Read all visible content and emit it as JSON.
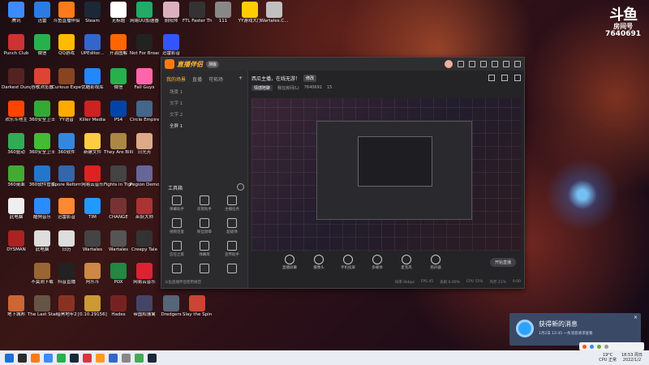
{
  "watermark": {
    "logo": "斗鱼",
    "room_label": "房间号",
    "room_number": "7640691"
  },
  "desktop_icons": [
    {
      "label": "腾讯",
      "color": "#3d8bff"
    },
    {
      "label": "迅雷",
      "color": "#2a7be4"
    },
    {
      "label": "斗鱼直播伴侣",
      "color": "#ff7a1a"
    },
    {
      "label": "Steam",
      "color": "#1b2838"
    },
    {
      "label": "无标题",
      "color": "#ffffff"
    },
    {
      "label": "网易UU加速器",
      "color": "#22aa66"
    },
    {
      "label": "阴阳师",
      "color": "#ddb0c0"
    },
    {
      "label": "FTL Faster Than Light",
      "color": "#333333"
    },
    {
      "label": "111",
      "color": "#888888"
    },
    {
      "label": "YY游戏大厅",
      "color": "#ffcc00"
    },
    {
      "label": "Wartales.C...",
      "color": "#c0c0c0"
    },
    {
      "label": "Punch Club",
      "color": "#cc3333"
    },
    {
      "label": "微信",
      "color": "#26b14d"
    },
    {
      "label": "QQ游戏",
      "color": "#ffbb00"
    },
    {
      "label": "UPEditor...",
      "color": "#3366cc"
    },
    {
      "label": "开源图解",
      "color": "#ff6600"
    },
    {
      "label": "Not For Broadcast",
      "color": "#222222"
    },
    {
      "label": "迅雷影音",
      "color": "#3355ff"
    },
    {
      "label": "",
      "color": "#000000"
    },
    {
      "label": "",
      "color": "#000000"
    },
    {
      "label": "",
      "color": "#000000"
    },
    {
      "label": "",
      "color": "#000000"
    },
    {
      "label": "Darkest Dungeon",
      "color": "#552222"
    },
    {
      "label": "谷歌浏览器",
      "color": "#dd4433"
    },
    {
      "label": "Curious Expedition",
      "color": "#884422"
    },
    {
      "label": "优酷影视库",
      "color": "#2288ff"
    },
    {
      "label": "微信",
      "color": "#26b14d"
    },
    {
      "label": "Fall Guys",
      "color": "#ff66aa"
    },
    {
      "label": "",
      "color": "#000000"
    },
    {
      "label": "",
      "color": "#000000"
    },
    {
      "label": "",
      "color": "#000000"
    },
    {
      "label": "",
      "color": "#000000"
    },
    {
      "label": "",
      "color": "#000000"
    },
    {
      "label": "欢乐斗地主",
      "color": "#ff4400"
    },
    {
      "label": "360安全卫士",
      "color": "#33aa33"
    },
    {
      "label": "YY语音",
      "color": "#ffaa00"
    },
    {
      "label": "Killer Media",
      "color": "#cc2222"
    },
    {
      "label": "PS4",
      "color": "#0044aa"
    },
    {
      "label": "Circle Empire",
      "color": "#446688"
    },
    {
      "label": "",
      "color": "#000000"
    },
    {
      "label": "",
      "color": "#000000"
    },
    {
      "label": "",
      "color": "#000000"
    },
    {
      "label": "",
      "color": "#000000"
    },
    {
      "label": "",
      "color": "#000000"
    },
    {
      "label": "360驱动",
      "color": "#33aa55"
    },
    {
      "label": "360安全卫士",
      "color": "#44bb33"
    },
    {
      "label": "360软件",
      "color": "#3388dd"
    },
    {
      "label": "新建文件",
      "color": "#ffcc44"
    },
    {
      "label": "They Are Billions",
      "color": "#aa8844"
    },
    {
      "label": "日光芳",
      "color": "#ddaa88"
    },
    {
      "label": "",
      "color": "#000000"
    },
    {
      "label": "",
      "color": "#000000"
    },
    {
      "label": "",
      "color": "#000000"
    },
    {
      "label": "",
      "color": "#000000"
    },
    {
      "label": "",
      "color": "#000000"
    },
    {
      "label": "360桌面",
      "color": "#44aa33"
    },
    {
      "label": "360软件管家",
      "color": "#2277cc"
    },
    {
      "label": "Spore Reformed",
      "color": "#3366aa"
    },
    {
      "label": "网易云音乐",
      "color": "#dd2222"
    },
    {
      "label": "Fights in Tight",
      "color": "#444444"
    },
    {
      "label": "Pegion Demon",
      "color": "#666699"
    },
    {
      "label": "",
      "color": "#000000"
    },
    {
      "label": "",
      "color": "#000000"
    },
    {
      "label": "",
      "color": "#000000"
    },
    {
      "label": "",
      "color": "#000000"
    },
    {
      "label": "",
      "color": "#000000"
    },
    {
      "label": "此电脑",
      "color": "#eeeeee"
    },
    {
      "label": "酷狗音乐",
      "color": "#2a8cff"
    },
    {
      "label": "迅雷影音",
      "color": "#ff8833"
    },
    {
      "label": "TIM",
      "color": "#2299ff"
    },
    {
      "label": "CHANGE",
      "color": "#773333"
    },
    {
      "label": "巫妖大师",
      "color": "#aa3333"
    },
    {
      "label": "",
      "color": "#000000"
    },
    {
      "label": "",
      "color": "#000000"
    },
    {
      "label": "",
      "color": "#000000"
    },
    {
      "label": "",
      "color": "#000000"
    },
    {
      "label": "",
      "color": "#000000"
    },
    {
      "label": "DYSMAN",
      "color": "#aa2222"
    },
    {
      "label": "此电脑",
      "color": "#dddddd"
    },
    {
      "label": "日历",
      "color": "#dddddd"
    },
    {
      "label": "Wartales",
      "color": "#444444"
    },
    {
      "label": "Wartales",
      "color": "#555555"
    },
    {
      "label": "Creepy Tale",
      "color": "#333333"
    },
    {
      "label": "",
      "color": "#000000"
    },
    {
      "label": "",
      "color": "#000000"
    },
    {
      "label": "",
      "color": "#000000"
    },
    {
      "label": "",
      "color": "#000000"
    },
    {
      "label": "",
      "color": "#000000"
    },
    {
      "label": "",
      "color": "#000000"
    },
    {
      "label": "不莫测下载",
      "color": "#996633"
    },
    {
      "label": "抖音直播",
      "color": "#222222"
    },
    {
      "label": "阿乐斗",
      "color": "#cc8844"
    },
    {
      "label": "POX",
      "color": "#228844"
    },
    {
      "label": "网易云音乐",
      "color": "#dd2233"
    },
    {
      "label": "万兴喵影",
      "color": "#ff5544"
    },
    {
      "label": "",
      "color": "#000000"
    },
    {
      "label": "",
      "color": "#000000"
    },
    {
      "label": "",
      "color": "#000000"
    },
    {
      "label": "",
      "color": "#000000"
    },
    {
      "label": "地下城邦",
      "color": "#cc6633"
    },
    {
      "label": "The Last Stand",
      "color": "#665544"
    },
    {
      "label": "暗黑地牢2",
      "color": "#883322"
    },
    {
      "label": "[0.10.29156] 流放者",
      "color": "#cc9933"
    },
    {
      "label": "Hades",
      "color": "#772222"
    },
    {
      "label": "帝国和藩篱",
      "color": "#444466"
    },
    {
      "label": "Dredgers",
      "color": "#556677"
    },
    {
      "label": "Slay the Spire",
      "color": "#cc4433"
    },
    {
      "label": "",
      "color": "#000000"
    },
    {
      "label": "",
      "color": "#000000"
    },
    {
      "label": "",
      "color": "#000000"
    }
  ],
  "app": {
    "name": "直播伴侣",
    "version": "测版",
    "sidebar_tabs": [
      "我的场景",
      "直播",
      "可拓场",
      "+"
    ],
    "scenes": [
      "场景 1",
      "文字 1",
      "文字 2",
      "全屏 1"
    ],
    "tools_title": "工具箱",
    "tools": [
      "弹幕助手",
      "房管助手",
      "主播任务",
      "视频连麦",
      "粉丝勋章",
      "超级弹",
      "信任之家",
      "弹幕库",
      "宣传助手",
      "",
      "",
      ""
    ],
    "notice": "斗鱼直播伴侣使用规范",
    "live_title": "西瓜主播，在线无游！",
    "edit": "修改",
    "meta_tag": "情感陪聊",
    "meta_room": "我在房间(L)",
    "meta_id": "7640691",
    "meta_count": "15",
    "controls": [
      "直播屏幕",
      "摄像头",
      "手机投屏",
      "多媒体",
      "麦克风",
      "扬声器"
    ],
    "start": "开始直播",
    "status": [
      "码率 0kbps",
      "FPS 45",
      "丢帧 0.00%",
      "CPU 15%",
      "内存 21%",
      "0:00"
    ]
  },
  "notification": {
    "title": "获得新的消息",
    "body": "1月2日 12:45 一条消息请求查看"
  },
  "taskbar": {
    "clock_time": "18:53 周日",
    "clock_date": "2022/1/2",
    "weather": "19°C",
    "weather2": "CPU 正常"
  }
}
